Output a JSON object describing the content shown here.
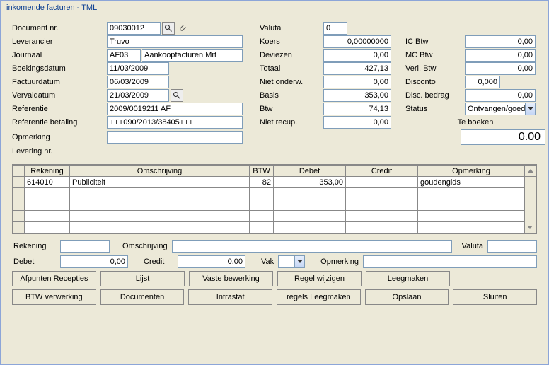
{
  "title_prefix": "inkomende facturen",
  "title_sep": "   -   ",
  "title_suffix": "TML",
  "labels": {
    "document_nr": "Document nr.",
    "leverancier": "Leverancier",
    "journaal": "Journaal",
    "boekingsdatum": "Boekingsdatum",
    "factuurdatum": "Factuurdatum",
    "vervaldatum": "Vervaldatum",
    "referentie": "Referentie",
    "referentie_betaling": "Referentie betaling",
    "opmerking": "Opmerking",
    "levering_nr": "Levering nr.",
    "valuta": "Valuta",
    "koers": "Koers",
    "deviezen": "Deviezen",
    "totaal": "Totaal",
    "niet_onderw": "Niet onderw.",
    "basis": "Basis",
    "btw": "Btw",
    "niet_recup": "Niet recup.",
    "ic_btw": "IC Btw",
    "mc_btw": "MC Btw",
    "verl_btw": "Verl. Btw",
    "disconto": "Disconto",
    "disc_bedrag": "Disc. bedrag",
    "status": "Status",
    "te_boeken": "Te boeken"
  },
  "values": {
    "document_nr": "09030012",
    "leverancier": "Truvo",
    "journaal_code": "AF03",
    "journaal_naam": "Aankoopfacturen Mrt",
    "boekingsdatum": "11/03/2009",
    "factuurdatum": "06/03/2009",
    "vervaldatum": "21/03/2009",
    "referentie": "2009/0019211 AF",
    "referentie_betaling": "+++090/2013/38405+++",
    "opmerking": "",
    "levering_nr": "",
    "valuta": "0",
    "koers": "0,00000000",
    "deviezen": "0,00",
    "totaal": "427,13",
    "niet_onderw": "0,00",
    "basis": "353,00",
    "btw": "74,13",
    "niet_recup": "0,00",
    "ic_btw": "0,00",
    "mc_btw": "0,00",
    "verl_btw": "0,00",
    "disconto": "0,000",
    "disc_bedrag": "0,00",
    "status": "Ontvangen/goed",
    "te_boeken": "0.00"
  },
  "grid": {
    "headers": {
      "rekening": "Rekening",
      "omschrijving": "Omschrijving",
      "btw": "BTW",
      "debet": "Debet",
      "credit": "Credit",
      "opmerking": "Opmerking"
    },
    "rows": [
      {
        "rekening": "614010",
        "omschrijving": "Publiciteit",
        "btw": "82",
        "debet": "353,00",
        "credit": "",
        "opmerking": "goudengids"
      }
    ]
  },
  "edit": {
    "labels": {
      "rekening": "Rekening",
      "omschrijving": "Omschrijving",
      "valuta": "Valuta",
      "debet": "Debet",
      "credit": "Credit",
      "vak": "Vak",
      "opmerking": "Opmerking"
    },
    "values": {
      "rekening": "",
      "omschrijving": "",
      "valuta": "",
      "debet": "0,00",
      "credit": "0,00",
      "vak": "",
      "opmerking": ""
    }
  },
  "buttons": {
    "row1": [
      "Afpunten Recepties",
      "Lijst",
      "Vaste bewerking",
      "Regel wijzigen",
      "Leegmaken",
      ""
    ],
    "row2": [
      "BTW verwerking",
      "Documenten",
      "Intrastat",
      "regels Leegmaken",
      "Opslaan",
      "Sluiten"
    ]
  }
}
